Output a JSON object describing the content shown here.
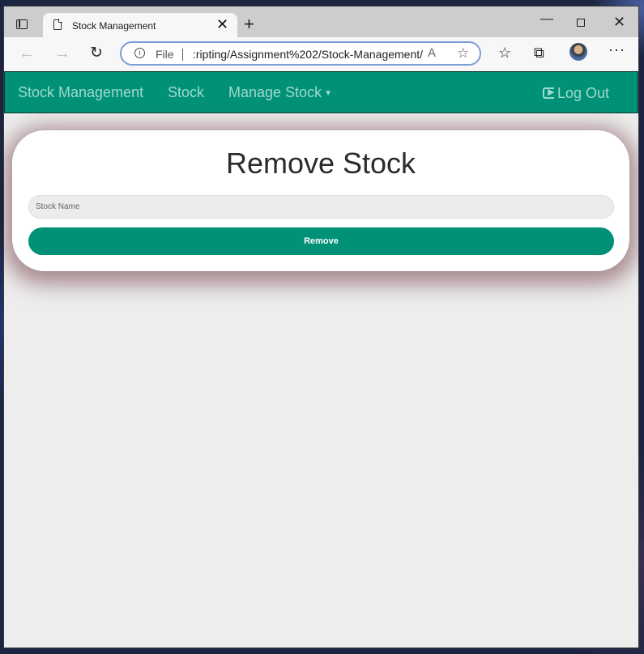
{
  "browser": {
    "tab_title": "Stock Management",
    "address_scheme": "File",
    "address_url": ":ripting/Assignment%202/Stock-Management/"
  },
  "navbar": {
    "brand": "Stock Management",
    "links": [
      {
        "label": "Stock"
      },
      {
        "label": "Manage Stock",
        "has_dropdown": true
      }
    ],
    "logout_label": "Log Out"
  },
  "form": {
    "title": "Remove Stock",
    "stock_name_placeholder": "Stock Name",
    "stock_name_value": "",
    "submit_label": "Remove"
  },
  "colors": {
    "navbar_bg": "#009177",
    "button_bg": "#009177",
    "page_bg": "#ededed"
  }
}
